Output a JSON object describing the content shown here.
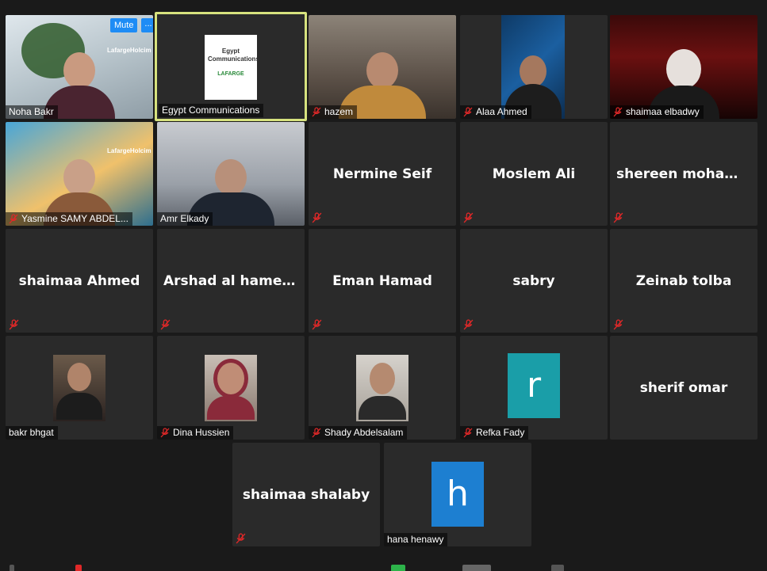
{
  "controls": {
    "mute_label": "Mute",
    "more_label": "..."
  },
  "participants": [
    {
      "name": "Noha Bakr",
      "display": "video",
      "muted": false
    },
    {
      "name": "Egypt Communications",
      "display": "video",
      "muted": false,
      "active_speaker": true,
      "card_title": "Egypt Communications",
      "card_brand": "LAFARGE"
    },
    {
      "name": "hazem",
      "display": "video",
      "muted": true
    },
    {
      "name": "Alaa Ahmed",
      "display": "video",
      "muted": true
    },
    {
      "name": "shaimaa elbadwy",
      "display": "video",
      "muted": true
    },
    {
      "name": "Yasmine SAMY ABDEL...",
      "display": "video",
      "muted": true
    },
    {
      "name": "Amr Elkady",
      "display": "video",
      "muted": false
    },
    {
      "name": "Nermine Seif",
      "display": "name",
      "muted": true
    },
    {
      "name": "Moslem Ali",
      "display": "name",
      "muted": true
    },
    {
      "name": "shereen  moham...",
      "display": "name",
      "muted": true
    },
    {
      "name": "shaimaa Ahmed",
      "display": "name",
      "muted": true
    },
    {
      "name": "Arshad al hamedy",
      "display": "name",
      "muted": true
    },
    {
      "name": "Eman Hamad",
      "display": "name",
      "muted": true
    },
    {
      "name": "sabry",
      "display": "name",
      "muted": true
    },
    {
      "name": "Zeinab tolba",
      "display": "name",
      "muted": true
    },
    {
      "name": "bakr bhgat",
      "display": "photo",
      "muted": false
    },
    {
      "name": "Dina Hussien",
      "display": "photo",
      "muted": true
    },
    {
      "name": "Shady Abdelsalam",
      "display": "photo",
      "muted": true
    },
    {
      "name": "Refka Fady",
      "display": "avatar",
      "muted": true,
      "avatar_letter": "r",
      "avatar_color": "#1a9ea8"
    },
    {
      "name": "sherif omar",
      "display": "name",
      "muted": false
    },
    {
      "name": "shaimaa shalaby",
      "display": "name",
      "muted": true
    },
    {
      "name": "hana henawy",
      "display": "avatar",
      "muted": false,
      "avatar_letter": "h",
      "avatar_color": "#1d7fd1"
    }
  ],
  "brand_marks": {
    "tile_1": "LafargeHolcim",
    "tile_6": "LafargeHolcim"
  },
  "colors": {
    "active_border": "#d7e27e",
    "mute_red": "#e02828",
    "button_blue": "#1e8cf5"
  }
}
